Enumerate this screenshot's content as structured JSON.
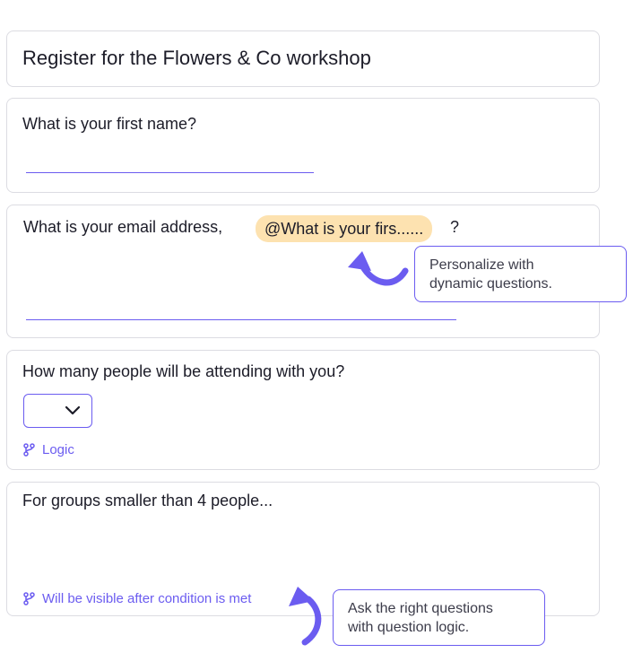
{
  "form": {
    "title": "Register for the Flowers & Co workshop",
    "questions": [
      {
        "label": "What is your first name?"
      },
      {
        "label": "What is your email address,",
        "mention": "@What is your firs......",
        "suffix": "?"
      },
      {
        "label": "How many people will be attending with you?",
        "select_value": "",
        "logic_label": "Logic"
      },
      {
        "label": "For groups smaller than 4 people...",
        "condition_label": "Will be visible after condition is met"
      }
    ]
  },
  "callouts": {
    "personalize": {
      "line1": "Personalize with",
      "line2": "dynamic questions."
    },
    "logic": {
      "line1": "Ask the right questions",
      "line2": "with question logic."
    }
  },
  "colors": {
    "accent": "#6b5cf0",
    "mention_bg": "#fde2b0",
    "border": "#dcdce2"
  },
  "icons": {
    "select": "chevron-down-icon",
    "logic": "branch-icon"
  }
}
